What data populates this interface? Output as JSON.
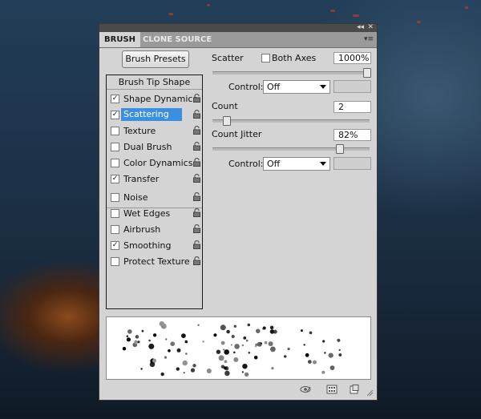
{
  "tabs": [
    {
      "label": "BRUSH"
    },
    {
      "label": "CLONE SOURCE"
    }
  ],
  "brush_presets_button": "Brush Presets",
  "brush_tip_shape_label": "Brush Tip Shape",
  "options": [
    {
      "label": "Shape Dynamics",
      "checked": true,
      "selected": false
    },
    {
      "label": "Scattering",
      "checked": true,
      "selected": true
    },
    {
      "label": "Texture",
      "checked": false,
      "selected": false
    },
    {
      "label": "Dual Brush",
      "checked": false,
      "selected": false
    },
    {
      "label": "Color Dynamics",
      "checked": false,
      "selected": false
    },
    {
      "label": "Transfer",
      "checked": true,
      "selected": false
    },
    {
      "label": "Noise",
      "checked": false,
      "selected": false
    },
    {
      "label": "Wet Edges",
      "checked": false,
      "selected": false
    },
    {
      "label": "Airbrush",
      "checked": false,
      "selected": false
    },
    {
      "label": "Smoothing",
      "checked": true,
      "selected": false
    },
    {
      "label": "Protect Texture",
      "checked": false,
      "selected": false
    }
  ],
  "scatter": {
    "label": "Scatter",
    "both_axes_label": "Both Axes",
    "both_axes_checked": false,
    "value": "1000%",
    "slider_fraction": 1.0
  },
  "control_label": "Control:",
  "control1": {
    "value": "Off"
  },
  "count": {
    "label": "Count",
    "value": "2",
    "slider_fraction": 0.07
  },
  "count_jitter": {
    "label": "Count Jitter",
    "value": "82%",
    "slider_fraction": 0.82
  },
  "control2": {
    "value": "Off"
  },
  "colors": {
    "selection": "#3b8fe0",
    "panel": "#d4d4d4"
  }
}
